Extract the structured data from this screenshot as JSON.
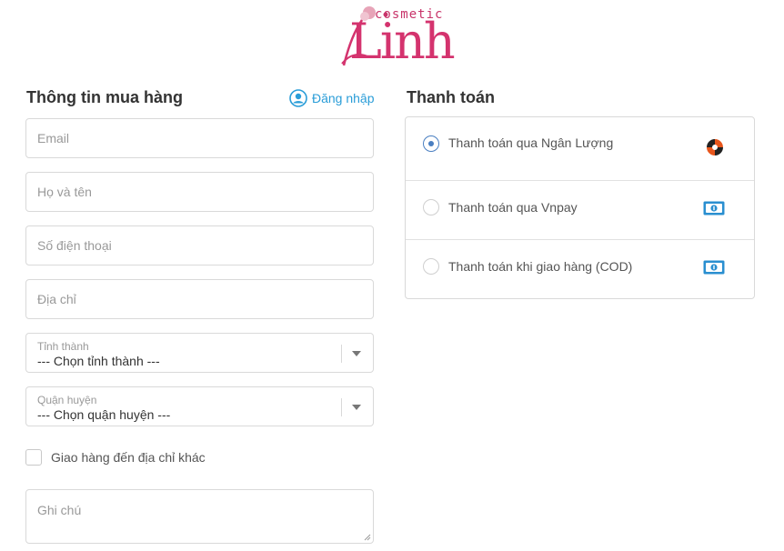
{
  "brand": {
    "logo_small": "cosmetic",
    "logo_main": "Linh"
  },
  "left": {
    "title": "Thông tin mua hàng",
    "login_label": "Đăng nhập",
    "fields": {
      "email_placeholder": "Email",
      "name_placeholder": "Họ và tên",
      "phone_placeholder": "Số điện thoại",
      "address_placeholder": "Địa chỉ"
    },
    "province": {
      "label": "Tỉnh thành",
      "value": "--- Chọn tỉnh thành ---"
    },
    "district": {
      "label": "Quận huyện",
      "value": "--- Chọn quận huyện ---"
    },
    "ship_other_label": "Giao hàng đến địa chỉ khác",
    "note_placeholder": "Ghi chú"
  },
  "right": {
    "title": "Thanh toán",
    "methods": [
      {
        "label": "Thanh toán qua Ngân Lượng",
        "selected": true,
        "icon": "nganluong-icon"
      },
      {
        "label": "Thanh toán qua Vnpay",
        "selected": false,
        "icon": "cash-icon"
      },
      {
        "label": "Thanh toán khi giao hàng (COD)",
        "selected": false,
        "icon": "cash-icon"
      }
    ]
  },
  "colors": {
    "brand": "#d4336e",
    "link": "#2a9dd8",
    "radio_selected": "#4a7fc1",
    "cash_icon": "#2a8fd0"
  }
}
